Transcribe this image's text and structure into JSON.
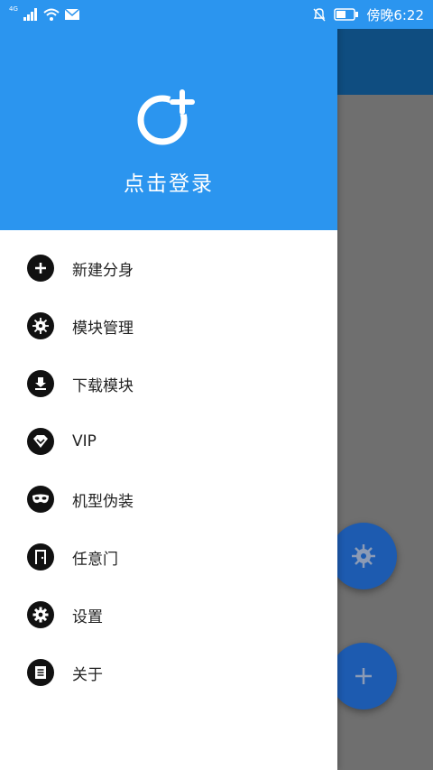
{
  "status_bar": {
    "network": "4G",
    "time": "傍晚6:22"
  },
  "drawer": {
    "login_text": "点击登录",
    "menu": [
      {
        "label": "新建分身",
        "icon": "plus-icon"
      },
      {
        "label": "模块管理",
        "icon": "virus-module-icon"
      },
      {
        "label": "下载模块",
        "icon": "download-icon"
      },
      {
        "label": "VIP",
        "icon": "diamond-icon"
      },
      {
        "label": "机型伪装",
        "icon": "mask-icon"
      },
      {
        "label": "任意门",
        "icon": "door-icon"
      },
      {
        "label": "设置",
        "icon": "gear-icon"
      },
      {
        "label": "关于",
        "icon": "document-icon"
      }
    ]
  },
  "background_app": {
    "fab_icons": [
      "virus-module-icon",
      "plus-icon"
    ]
  },
  "colors": {
    "primary": "#2b95ef",
    "toolbar_dark": "#0f4d80",
    "fab": "#1d5bb0",
    "scrim": "#6f6f6f"
  }
}
